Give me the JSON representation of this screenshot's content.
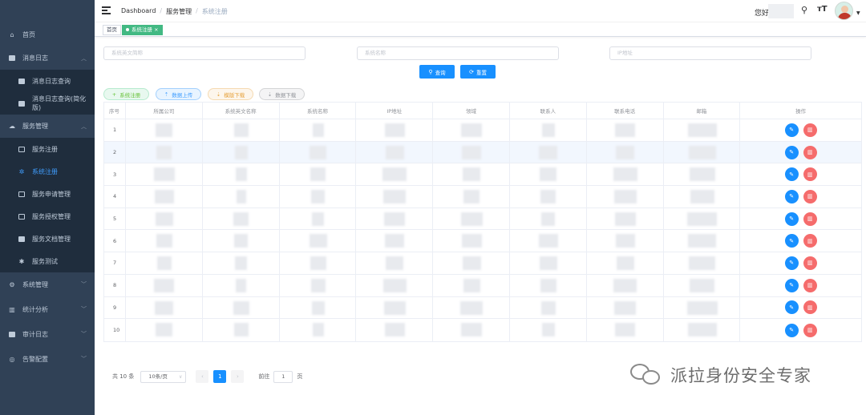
{
  "sidebar": {
    "items": [
      {
        "label": "首页",
        "icon": "home-icon"
      },
      {
        "label": "消息日志",
        "icon": "message-icon",
        "expanded": true,
        "children": [
          {
            "label": "消息日志查询",
            "icon": "message-icon"
          },
          {
            "label": "消息日志查询(简化版)",
            "icon": "message-icon"
          }
        ]
      },
      {
        "label": "服务管理",
        "icon": "cloud-icon",
        "expanded": true,
        "children": [
          {
            "label": "服务注册",
            "icon": "list-icon"
          },
          {
            "label": "系统注册",
            "icon": "gear-icon",
            "active": true
          },
          {
            "label": "服务申请管理",
            "icon": "apply-icon"
          },
          {
            "label": "服务授权管理",
            "icon": "auth-icon"
          },
          {
            "label": "服务文档管理",
            "icon": "doc-icon"
          },
          {
            "label": "服务测试",
            "icon": "bug-icon"
          }
        ]
      },
      {
        "label": "系统管理",
        "icon": "settings-icon"
      },
      {
        "label": "统计分析",
        "icon": "stats-icon"
      },
      {
        "label": "审计日志",
        "icon": "audit-icon"
      },
      {
        "label": "告警配置",
        "icon": "alert-icon"
      }
    ]
  },
  "header": {
    "breadcrumb": [
      "Dashboard",
      "服务管理",
      "系统注册"
    ],
    "greeting": "您好"
  },
  "tags": [
    {
      "label": "首页",
      "active": false
    },
    {
      "label": "系统注册",
      "active": true,
      "close": "×"
    }
  ],
  "search": {
    "field1_placeholder": "系统英文简称",
    "field2_placeholder": "系统名称",
    "field3_placeholder": "IP地址",
    "query_label": "查询",
    "reset_label": "重置"
  },
  "actions": {
    "register": "系统注册",
    "upload": "数据上传",
    "template": "模版下载",
    "download": "数据下载"
  },
  "table": {
    "columns": [
      "序号",
      "所属公司",
      "系统英文名称",
      "系统名称",
      "IP地址",
      "领域",
      "联系人",
      "联系电话",
      "邮箱",
      "操作"
    ],
    "rows": [
      "1",
      "2",
      "3",
      "4",
      "5",
      "6",
      "7",
      "8",
      "9",
      "10"
    ],
    "highlight_row": 2
  },
  "pagination": {
    "total": "共 10 条",
    "page_size": "10条/页",
    "prev": "‹",
    "current": "1",
    "next": "›",
    "goto_prefix": "前往",
    "goto_value": "1",
    "goto_suffix": "页"
  },
  "watermark": "派拉身份安全专家",
  "colors": {
    "sidebar_bg": "#304156",
    "primary": "#1890ff",
    "danger": "#f56c6c",
    "tag_active": "#42b983"
  }
}
